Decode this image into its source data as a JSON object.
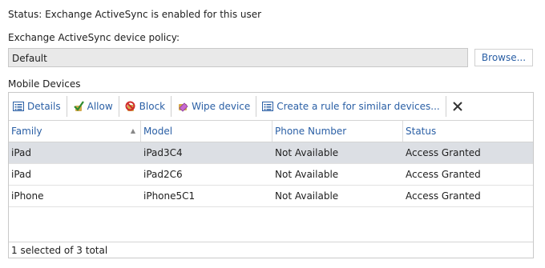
{
  "status_text": "Status: Exchange ActiveSync is enabled for this user",
  "policy": {
    "label": "Exchange ActiveSync device policy:",
    "value": "Default",
    "browse_label": "Browse..."
  },
  "mobile_devices": {
    "section_label": "Mobile Devices",
    "toolbar": {
      "details": "Details",
      "allow": "Allow",
      "block": "Block",
      "wipe": "Wipe device",
      "create_rule": "Create a rule for similar devices..."
    },
    "columns": [
      "Family",
      "Model",
      "Phone Number",
      "Status"
    ],
    "rows": [
      {
        "family": "iPad",
        "model": "iPad3C4",
        "phone": "Not Available",
        "status": "Access Granted"
      },
      {
        "family": "iPad",
        "model": "iPad2C6",
        "phone": "Not Available",
        "status": "Access Granted"
      },
      {
        "family": "iPhone",
        "model": "iPhone5C1",
        "phone": "Not Available",
        "status": "Access Granted"
      }
    ],
    "footer": "1 selected of 3 total"
  }
}
